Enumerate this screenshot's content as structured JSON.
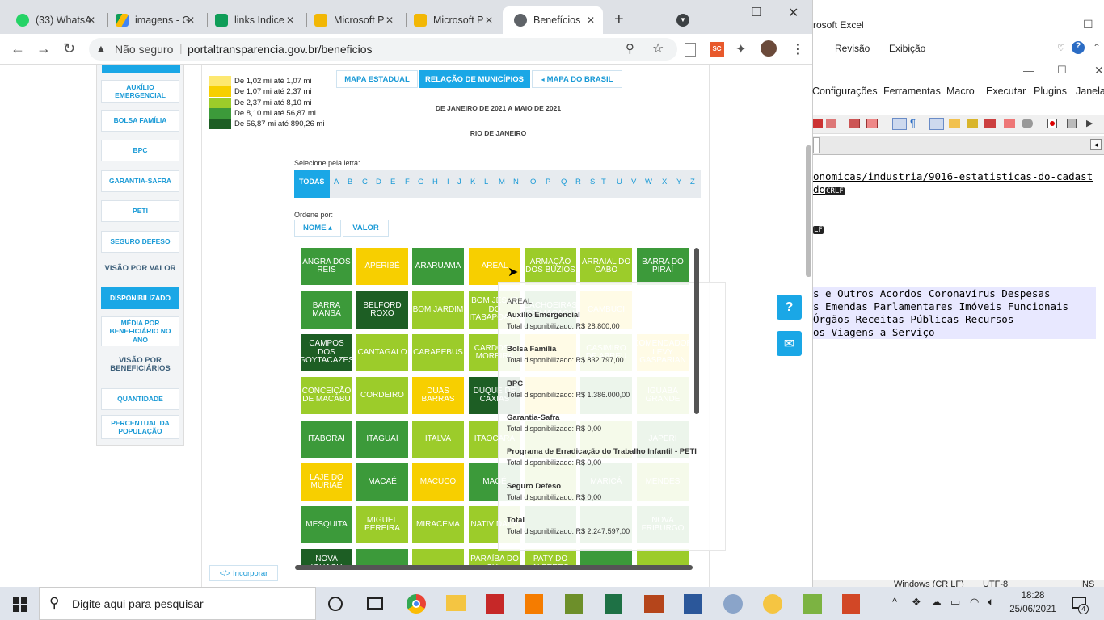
{
  "browser": {
    "tabs": [
      {
        "label": "(33) WhatsA",
        "color": "#25d366",
        "icon": "whatsapp-icon"
      },
      {
        "label": "imagens - G",
        "color": "#fbbc04",
        "icon": "google-drive-icon"
      },
      {
        "label": "links Indice",
        "color": "#0f9d58",
        "icon": "google-sheets-icon"
      },
      {
        "label": "Microsoft P",
        "color": "#f2b705",
        "icon": "power-bi-icon"
      },
      {
        "label": "Microsoft P",
        "color": "#f2b705",
        "icon": "power-bi-icon"
      },
      {
        "label": "Benefícios",
        "color": "#5f6368",
        "icon": "globe-icon"
      }
    ],
    "security_label": "Não seguro",
    "url": "portaltransparencia.gov.br/beneficios"
  },
  "excel": {
    "title": "rosoft Excel",
    "menu": [
      "Revisão",
      "Exibição"
    ]
  },
  "notepad": {
    "menu": [
      "Configurações",
      "Ferramentas",
      "Macro",
      "Executar",
      "Plugins",
      "Janela"
    ],
    "lines": [
      "onomicas/industria/9016-estatisticas-do-cadast",
      "do",
      "",
      "",
      "",
      "s e Outros Acordos Coronavírus Despesas",
      "s Emendas Parlamentares Imóveis Funcionais",
      "Órgãos Receitas Públicas Recursos",
      "os Viagens a Serviço"
    ],
    "crlf": "CRLF",
    "lf": "LF",
    "status_eol": "Windows (CR LF)",
    "status_enc": "UTF-8",
    "status_ins": "INS"
  },
  "sidebar": {
    "items": [
      {
        "label": "AUXÍLIO EMERGENCIAL",
        "kind": "btn"
      },
      {
        "label": "BOLSA FAMÍLIA",
        "kind": "btn"
      },
      {
        "label": "BPC",
        "kind": "btn"
      },
      {
        "label": "GARANTIA-SAFRA",
        "kind": "btn"
      },
      {
        "label": "PETI",
        "kind": "btn"
      },
      {
        "label": "SEGURO DEFESO",
        "kind": "btn"
      },
      {
        "label": "VISÃO POR VALOR",
        "kind": "head"
      },
      {
        "label": "DISPONIBILIZADO",
        "kind": "active"
      },
      {
        "label": "MÉDIA POR BENEFICIÁRIO NO ANO",
        "kind": "btn"
      },
      {
        "label": "VISÃO POR BENEFICIÁRIOS",
        "kind": "head"
      },
      {
        "label": "QUANTIDADE",
        "kind": "btn"
      },
      {
        "label": "PERCENTUAL DA POPULAÇÃO",
        "kind": "btn"
      }
    ]
  },
  "legend": [
    {
      "label": "De 1,02 mi até 1,07 mi",
      "color": "#fde871"
    },
    {
      "label": "De 1,07 mi até 2,37 mi",
      "color": "#f7cf00"
    },
    {
      "label": "De 2,37 mi até 8,10 mi",
      "color": "#9ccc2a"
    },
    {
      "label": "De 8,10 mi até 56,87 mi",
      "color": "#3c9a3a"
    },
    {
      "label": "De 56,87 mi até 890,26 mi",
      "color": "#1d5e24"
    }
  ],
  "view_buttons": [
    "MAPA ESTADUAL",
    "RELAÇÃO DE MUNICÍPIOS",
    "MAPA DO BRASIL"
  ],
  "period": "DE JANEIRO DE 2021 A MAIO DE 2021",
  "state": "RIO DE JANEIRO",
  "letter_label": "Selecione pela letra:",
  "letters": [
    "TODAS",
    "A",
    "B",
    "C",
    "D",
    "E",
    "F",
    "G",
    "H",
    "I",
    "J",
    "K",
    "L",
    "M",
    "N",
    "O",
    "P",
    "Q",
    "R",
    "S",
    "T",
    "U",
    "V",
    "W",
    "X",
    "Y",
    "Z"
  ],
  "sort_label": "Ordene por:",
  "sort_buttons": [
    "NOME ▴",
    "VALOR"
  ],
  "municipios": [
    {
      "name": "ANGRA DOS REIS",
      "color": "#3c9a3a"
    },
    {
      "name": "APERIBÉ",
      "color": "#f7cf00"
    },
    {
      "name": "ARARUAMA",
      "color": "#3c9a3a"
    },
    {
      "name": "AREAL",
      "color": "#f7cf00"
    },
    {
      "name": "ARMAÇÃO DOS BÚZIOS",
      "color": "#9ccc2a"
    },
    {
      "name": "ARRAIAL DO CABO",
      "color": "#9ccc2a"
    },
    {
      "name": "BARRA DO PIRAÍ",
      "color": "#3c9a3a"
    },
    {
      "name": "BARRA MANSA",
      "color": "#3c9a3a"
    },
    {
      "name": "BELFORD ROXO",
      "color": "#1d5e24"
    },
    {
      "name": "BOM JARDIM",
      "color": "#9ccc2a"
    },
    {
      "name": "BOM JESUS DO ITABAPOANA",
      "color": "#9ccc2a"
    },
    {
      "name": "CACHOEIRAS DE MACACU",
      "color": "#3c9a3a"
    },
    {
      "name": "CAMBUCI",
      "color": "#f7cf00"
    },
    {
      "name": "",
      "color": "#ffffff"
    },
    {
      "name": "CAMPOS DOS GOYTACAZES",
      "color": "#1d5e24"
    },
    {
      "name": "CANTAGALO",
      "color": "#9ccc2a"
    },
    {
      "name": "CARAPEBUS",
      "color": "#9ccc2a"
    },
    {
      "name": "CARDOSO MOREIRA",
      "color": "#9ccc2a"
    },
    {
      "name": "",
      "color": "#f7cf00"
    },
    {
      "name": "CASIMIRO DE ABREU",
      "color": "#9ccc2a"
    },
    {
      "name": "COMENDADOR LEVY GASPARIAN",
      "color": "#f7cf00"
    },
    {
      "name": "CONCEIÇÃO DE MACABU",
      "color": "#9ccc2a"
    },
    {
      "name": "CORDEIRO",
      "color": "#9ccc2a"
    },
    {
      "name": "DUAS BARRAS",
      "color": "#f7cf00"
    },
    {
      "name": "DUQUE DE CAXIAS",
      "color": "#1d5e24"
    },
    {
      "name": "",
      "color": "#f7cf00"
    },
    {
      "name": "",
      "color": "#3c9a3a"
    },
    {
      "name": "IGUABA GRANDE",
      "color": "#9ccc2a"
    },
    {
      "name": "ITABORAÍ",
      "color": "#3c9a3a"
    },
    {
      "name": "ITAGUAÍ",
      "color": "#3c9a3a"
    },
    {
      "name": "ITALVA",
      "color": "#9ccc2a"
    },
    {
      "name": "ITAOCARA",
      "color": "#9ccc2a"
    },
    {
      "name": "",
      "color": "#9ccc2a"
    },
    {
      "name": "",
      "color": "#9ccc2a"
    },
    {
      "name": "JAPERI",
      "color": "#3c9a3a"
    },
    {
      "name": "LAJE DO MURIAÉ",
      "color": "#f7cf00"
    },
    {
      "name": "MACAÉ",
      "color": "#3c9a3a"
    },
    {
      "name": "MACUCO",
      "color": "#f7cf00"
    },
    {
      "name": "MAGÉ",
      "color": "#3c9a3a"
    },
    {
      "name": "",
      "color": "#9ccc2a"
    },
    {
      "name": "MARICÁ",
      "color": "#3c9a3a"
    },
    {
      "name": "MENDES",
      "color": "#9ccc2a"
    },
    {
      "name": "MESQUITA",
      "color": "#3c9a3a"
    },
    {
      "name": "MIGUEL PEREIRA",
      "color": "#9ccc2a"
    },
    {
      "name": "MIRACEMA",
      "color": "#9ccc2a"
    },
    {
      "name": "NATIVIDADE",
      "color": "#9ccc2a"
    },
    {
      "name": "",
      "color": "#3c9a3a"
    },
    {
      "name": "",
      "color": "#3c9a3a"
    },
    {
      "name": "NOVA FRIBURGO",
      "color": "#3c9a3a"
    },
    {
      "name": "NOVA IGUAÇU",
      "color": "#1d5e24"
    },
    {
      "name": "",
      "color": "#3c9a3a"
    },
    {
      "name": "",
      "color": "#9ccc2a"
    },
    {
      "name": "PARAÍBA DO SUL",
      "color": "#9ccc2a"
    },
    {
      "name": "PATY DO ALFERES",
      "color": "#9ccc2a"
    },
    {
      "name": "",
      "color": "#3c9a3a"
    },
    {
      "name": "",
      "color": "#9ccc2a"
    }
  ],
  "tooltip": {
    "city": "AREAL",
    "items": [
      {
        "title": "Auxílio Emergencial",
        "value": "Total disponibilizado: R$ 28.800,00"
      },
      {
        "title": "Bolsa Família",
        "value": "Total disponibilizado: R$ 832.797,00"
      },
      {
        "title": "BPC",
        "value": "Total disponibilizado: R$ 1.386.000,00"
      },
      {
        "title": "Garantia-Safra",
        "value": "Total disponibilizado: R$ 0,00"
      },
      {
        "title": "Programa de Erradicação do Trabalho Infantil - PETI",
        "value": "Total disponibilizado: R$ 0,00"
      },
      {
        "title": "Seguro Defeso",
        "value": "Total disponibilizado: R$ 0,00"
      },
      {
        "title": "Total",
        "value": "Total disponibilizado: R$ 2.247.597,00"
      }
    ]
  },
  "embed_label": "</> Incorporar",
  "taskbar": {
    "search_placeholder": "Digite aqui para pesquisar",
    "time": "18:28",
    "date": "25/06/2021",
    "notifications": "4"
  }
}
